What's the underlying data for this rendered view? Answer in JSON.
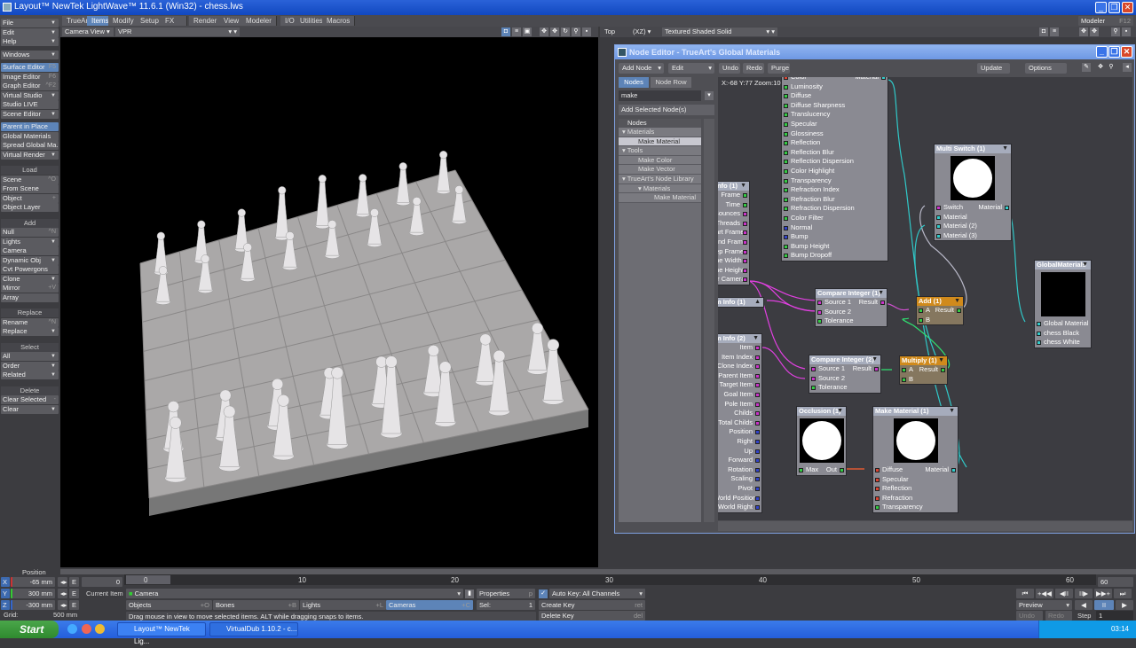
{
  "window": {
    "title": "Layout™ NewTek LightWave™ 11.6.1 (Win32) - chess.lws",
    "minimize": "_",
    "maximize": "❐",
    "close": "✕"
  },
  "tabs": [
    {
      "label": "TrueArt"
    },
    {
      "label": "Items",
      "active": true
    },
    {
      "label": "Modify"
    },
    {
      "label": "Setup"
    },
    {
      "label": "FX Tools"
    },
    {
      "label": "Render"
    },
    {
      "label": "View"
    },
    {
      "label": "Modeler Tools"
    },
    {
      "label": "I/O"
    },
    {
      "label": "Utilities"
    },
    {
      "label": "Macros"
    }
  ],
  "modeler_button": {
    "label": "Modeler",
    "shortcut": "F12"
  },
  "sidebar": [
    {
      "items": [
        {
          "label": "File",
          "dd": true
        },
        {
          "label": "Edit",
          "dd": true
        },
        {
          "label": "Help",
          "dd": true
        }
      ]
    },
    {
      "items": [
        {
          "label": "Windows",
          "dd": true
        }
      ]
    },
    {
      "items": [
        {
          "label": "Surface Editor",
          "sc": "F5",
          "hl": true
        },
        {
          "label": "Image Editor",
          "sc": "F6"
        },
        {
          "label": "Graph Editor",
          "sc": "^F2"
        },
        {
          "label": "Virtual Studio",
          "dd": true
        },
        {
          "label": "Studio LIVE"
        },
        {
          "label": "Scene Editor",
          "dd": true
        }
      ]
    },
    {
      "items": [
        {
          "label": "Parent in Place",
          "hl": true
        },
        {
          "label": "Global Materials"
        },
        {
          "label": "Spread Global Ma..."
        },
        {
          "label": "Virtual Render",
          "dd": true
        }
      ]
    },
    {
      "header": "Load",
      "items": [
        {
          "label": "Scene",
          "sc": "^O"
        },
        {
          "label": "From Scene"
        },
        {
          "label": "Object",
          "sc": "+"
        },
        {
          "label": "Object Layer"
        }
      ]
    },
    {
      "header": "Add",
      "items": [
        {
          "label": "Null",
          "sc": "^N"
        },
        {
          "label": "Lights",
          "dd": true
        },
        {
          "label": "Camera"
        },
        {
          "label": "Dynamic Obj",
          "dd": true
        },
        {
          "label": "Cvt Powergons"
        },
        {
          "label": "Clone",
          "dd": true
        },
        {
          "label": "Mirror",
          "sc": "+V"
        },
        {
          "label": "Array"
        }
      ]
    },
    {
      "header": "Replace",
      "items": [
        {
          "label": "Rename",
          "sc": "^N"
        },
        {
          "label": "Replace",
          "dd": true
        }
      ]
    },
    {
      "header": "Select",
      "items": [
        {
          "label": "All",
          "dd": true
        },
        {
          "label": "Order",
          "dd": true
        },
        {
          "label": "Related",
          "dd": true
        }
      ]
    },
    {
      "header": "Delete",
      "items": [
        {
          "label": "Clear Selected",
          "sc": "-"
        },
        {
          "label": "Clear",
          "dd": true
        }
      ]
    }
  ],
  "left_viewport": {
    "view": "Camera View",
    "mode": "VPR"
  },
  "right_viewport": {
    "view": "Top",
    "axis": "(XZ)",
    "mode": "Textured Shaded Solid"
  },
  "node_editor": {
    "title": "Node Editor - TrueArt's Global Materials",
    "toolbar": {
      "add_node": "Add Node",
      "edit": "Edit",
      "undo": "Undo",
      "redo": "Redo",
      "purge": "Purge",
      "update": "Update",
      "options": "Options"
    },
    "tabs": [
      "Nodes",
      "Node Row"
    ],
    "search": "make",
    "add_selected": "Add Selected Node(s)",
    "tree_header": "Nodes",
    "tree": [
      {
        "label": "Materials",
        "level": 0,
        "open": true
      },
      {
        "label": "Make Material",
        "level": 1,
        "selected": true
      },
      {
        "label": "Tools",
        "level": 0,
        "open": true
      },
      {
        "label": "Make Color",
        "level": 1
      },
      {
        "label": "Make Vector",
        "level": 1
      },
      {
        "label": "TrueArt's Node Library",
        "level": 0,
        "open": true
      },
      {
        "label": "Materials",
        "level": 1,
        "open": true
      },
      {
        "label": "Make Material",
        "level": 2
      }
    ],
    "coords": "X:-68 Y:77 Zoom:100%",
    "port_colors": {
      "scalar": "#33cc44",
      "integer": "#cc33cc",
      "vector": "#3344cc",
      "color": "#dd4433",
      "material": "#33cccc"
    },
    "nodes": [
      {
        "id": "surface",
        "title": "",
        "outputs": [
          [
            "Material",
            "material"
          ]
        ],
        "inputs": [
          [
            "Color",
            "color"
          ],
          [
            "Luminosity",
            "scalar"
          ],
          [
            "Diffuse",
            "scalar"
          ],
          [
            "Diffuse Sharpness",
            "scalar"
          ],
          [
            "Translucency",
            "scalar"
          ],
          [
            "Specular",
            "scalar"
          ],
          [
            "Glossiness",
            "scalar"
          ],
          [
            "Reflection",
            "scalar"
          ],
          [
            "Reflection Blur",
            "scalar"
          ],
          [
            "Reflection Dispersion",
            "scalar"
          ],
          [
            "Color Highlight",
            "scalar"
          ],
          [
            "Transparency",
            "scalar"
          ],
          [
            "Refraction Index",
            "scalar"
          ],
          [
            "Refraction Blur",
            "scalar"
          ],
          [
            "Refraction Dispersion",
            "scalar"
          ],
          [
            "Color Filter",
            "scalar"
          ],
          [
            "Normal",
            "vector"
          ],
          [
            "Bump",
            "vector"
          ],
          [
            "Bump Height",
            "scalar"
          ],
          [
            "Bump Dropoff",
            "scalar"
          ]
        ]
      },
      {
        "id": "info1",
        "title": "Info (1)",
        "outputs": [
          [
            "Frame",
            "scalar"
          ],
          [
            "Time",
            "scalar"
          ],
          [
            "Bounces",
            "integer"
          ],
          [
            "Threads",
            "integer"
          ],
          [
            "tart Frame",
            "integer"
          ],
          [
            "End Frame",
            "integer"
          ],
          [
            "tep Frame",
            "integer"
          ],
          [
            "me Width",
            "integer"
          ],
          [
            "me Height",
            "integer"
          ],
          [
            "er Camera",
            "integer"
          ]
        ]
      },
      {
        "id": "iteminfo1",
        "title": "m Info (1)",
        "collapsed": true
      },
      {
        "id": "iteminfo2",
        "title": "m Info (2)",
        "outputs": [
          [
            "Item",
            "integer"
          ],
          [
            "Item Index",
            "integer"
          ],
          [
            "Clone Index",
            "integer"
          ],
          [
            "Parent Item",
            "integer"
          ],
          [
            "Target Item",
            "integer"
          ],
          [
            "Goal Item",
            "integer"
          ],
          [
            "Pole Item",
            "integer"
          ],
          [
            "Childs",
            "integer"
          ],
          [
            "Total Childs",
            "integer"
          ],
          [
            "Position",
            "vector"
          ],
          [
            "Right",
            "vector"
          ],
          [
            "Up",
            "vector"
          ],
          [
            "Forward",
            "vector"
          ],
          [
            "Rotation",
            "vector"
          ],
          [
            "Scaling",
            "vector"
          ],
          [
            "Pivot",
            "vector"
          ],
          [
            "World Position",
            "vector"
          ],
          [
            "World Right",
            "vector"
          ]
        ]
      },
      {
        "id": "cmp1",
        "title": "Compare Integer (1)",
        "first_out": [
          "Result",
          "integer"
        ],
        "inputs": [
          [
            "Source 1",
            "integer"
          ],
          [
            "Source 2",
            "integer"
          ],
          [
            "Tolerance",
            "scalar"
          ]
        ]
      },
      {
        "id": "add1",
        "title": "Add (1)",
        "orange": true,
        "first_out": [
          "Result",
          "scalar"
        ],
        "inputs": [
          [
            "A",
            "scalar"
          ],
          [
            "B",
            "scalar"
          ]
        ]
      },
      {
        "id": "cmp2",
        "title": "Compare Integer (2)",
        "first_out": [
          "Result",
          "integer"
        ],
        "inputs": [
          [
            "Source 1",
            "integer"
          ],
          [
            "Source 2",
            "integer"
          ],
          [
            "Tolerance",
            "scalar"
          ]
        ]
      },
      {
        "id": "mul1",
        "title": "Multiply (1)",
        "orange": true,
        "first_out": [
          "Result",
          "scalar"
        ],
        "inputs": [
          [
            "A",
            "scalar"
          ],
          [
            "B",
            "scalar"
          ]
        ]
      },
      {
        "id": "occ1",
        "title": "Occlusion (1)",
        "preview": "white",
        "first_out": [
          "Out",
          "scalar"
        ],
        "inputs": [
          [
            "Max",
            "scalar"
          ]
        ]
      },
      {
        "id": "mm1",
        "title": "Make Material (1)",
        "preview": "white",
        "first_out": [
          "Material",
          "material"
        ],
        "inputs": [
          [
            "Diffuse",
            "color"
          ],
          [
            "Specular",
            "color"
          ],
          [
            "Reflection",
            "color"
          ],
          [
            "Refraction",
            "color"
          ],
          [
            "Transparency",
            "scalar"
          ]
        ]
      },
      {
        "id": "ms1",
        "title": "Multi Switch (1)",
        "preview": "white",
        "first_out": [
          "Material",
          "material"
        ],
        "inputs": [
          [
            "Switch",
            "integer"
          ],
          [
            "Material",
            "material"
          ],
          [
            "Material (2)",
            "material"
          ],
          [
            "Material (3)",
            "material"
          ]
        ]
      },
      {
        "id": "gm",
        "title": "GlobalMaterials",
        "preview": "black",
        "inputs": [
          [
            "Global Material",
            "material"
          ],
          [
            "chess Black",
            "material"
          ],
          [
            "chess White",
            "material"
          ]
        ]
      }
    ]
  },
  "bottom": {
    "position_label": "Position",
    "x": {
      "axis": "X",
      "value": "-65 mm"
    },
    "y": {
      "axis": "Y",
      "value": "300 mm"
    },
    "z": {
      "axis": "Z",
      "value": "-300 mm"
    },
    "e": "E",
    "grid_label": "Grid:",
    "grid_value": "500 mm",
    "frame_start": "0",
    "timeline_labels": [
      "0",
      "10",
      "20",
      "30",
      "40",
      "50",
      "60"
    ],
    "frame_end": "60",
    "current_item_label": "Current Item",
    "current_item": "Camera",
    "properties": "Properties",
    "properties_sc": "p",
    "sel_label": "Sel:",
    "sel_value": "1",
    "autokey": "Auto Key: All Channels",
    "autokey_checked": true,
    "create_key": "Create Key",
    "create_key_sc": "ret",
    "delete_key": "Delete Key",
    "delete_key_sc": "del",
    "item_types": [
      {
        "label": "Objects",
        "sc": "+O"
      },
      {
        "label": "Bones",
        "sc": "+B"
      },
      {
        "label": "Lights",
        "sc": "+L"
      },
      {
        "label": "Cameras",
        "sc": "+C",
        "active": true
      }
    ],
    "status": "Drag mouse in view to move selected items. ALT while dragging snaps to items.",
    "transport": [
      "⏮",
      "+◀◀",
      "◀II",
      "II▶",
      "▶▶+",
      "⏭"
    ],
    "preview": "Preview",
    "play_back": "◀",
    "pause": "II",
    "play": "▶",
    "undo": "Undo",
    "redo": "Redo",
    "step_label": "Step",
    "step_value": "1"
  },
  "taskbar": {
    "start": "Start",
    "tasks": [
      "Layout™ NewTek Lig...",
      "VirtualDub 1.10.2 - c..."
    ],
    "time": "03:14"
  }
}
